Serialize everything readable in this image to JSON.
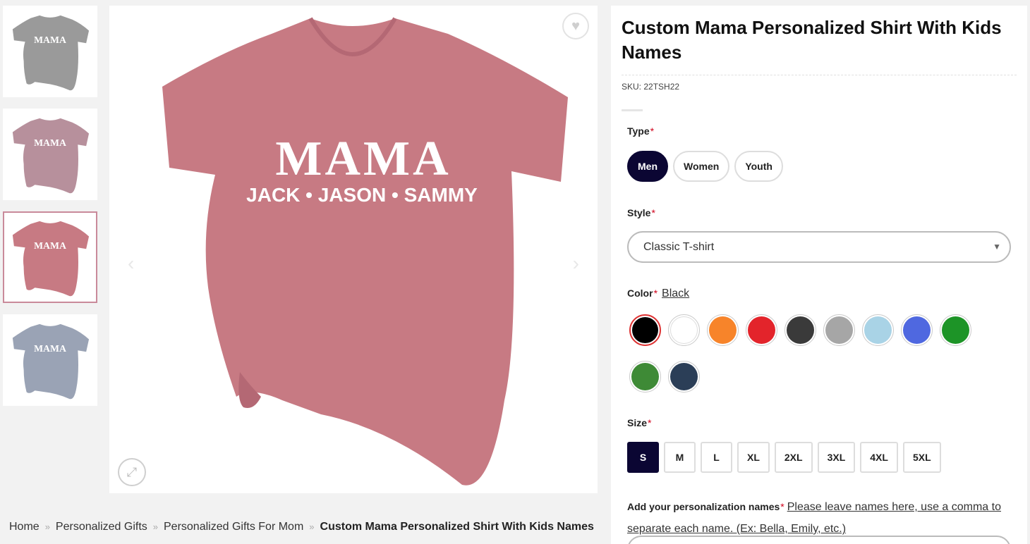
{
  "product": {
    "title": "Custom Mama Personalized Shirt With Kids Names",
    "sku_label": "SKU:",
    "sku": "22TSH22"
  },
  "image": {
    "print_main": "MAMA",
    "print_names": "JACK • JASON • SAMMY",
    "shirt_color": "#c77a83"
  },
  "thumbnails": [
    {
      "color": "#9a9a9a"
    },
    {
      "color": "#b7909c"
    },
    {
      "color": "#c77a83"
    },
    {
      "color": "#9aa3b5"
    }
  ],
  "options": {
    "type": {
      "label": "Type",
      "choices": [
        "Men",
        "Women",
        "Youth"
      ],
      "selected": "Men"
    },
    "style": {
      "label": "Style",
      "value": "Classic T-shirt"
    },
    "color": {
      "label": "Color",
      "value": "Black",
      "swatches": [
        "#000000",
        "#ffffff",
        "#f7842a",
        "#e3242b",
        "#3a3a3a",
        "#a6a6a6",
        "#a9d3e6",
        "#4f68e0",
        "#1d9427",
        "#3e8a36",
        "#2b3e57"
      ]
    },
    "size": {
      "label": "Size",
      "choices": [
        "S",
        "M",
        "L",
        "XL",
        "2XL",
        "3XL",
        "4XL",
        "5XL"
      ],
      "selected": "S"
    },
    "names": {
      "label": "Add your personalization names",
      "hint": "Please leave names here, use a comma to separate each name. (Ex: Bella, Emily, etc.)"
    }
  },
  "breadcrumb": {
    "items": [
      "Home",
      "Personalized Gifts",
      "Personalized Gifts For Mom"
    ],
    "current": "Custom Mama Personalized Shirt With Kids Names"
  },
  "icons": {
    "wishlist": "heart-icon",
    "prev": "chevron-left-icon",
    "next": "chevron-right-icon",
    "zoom": "expand-icon"
  }
}
